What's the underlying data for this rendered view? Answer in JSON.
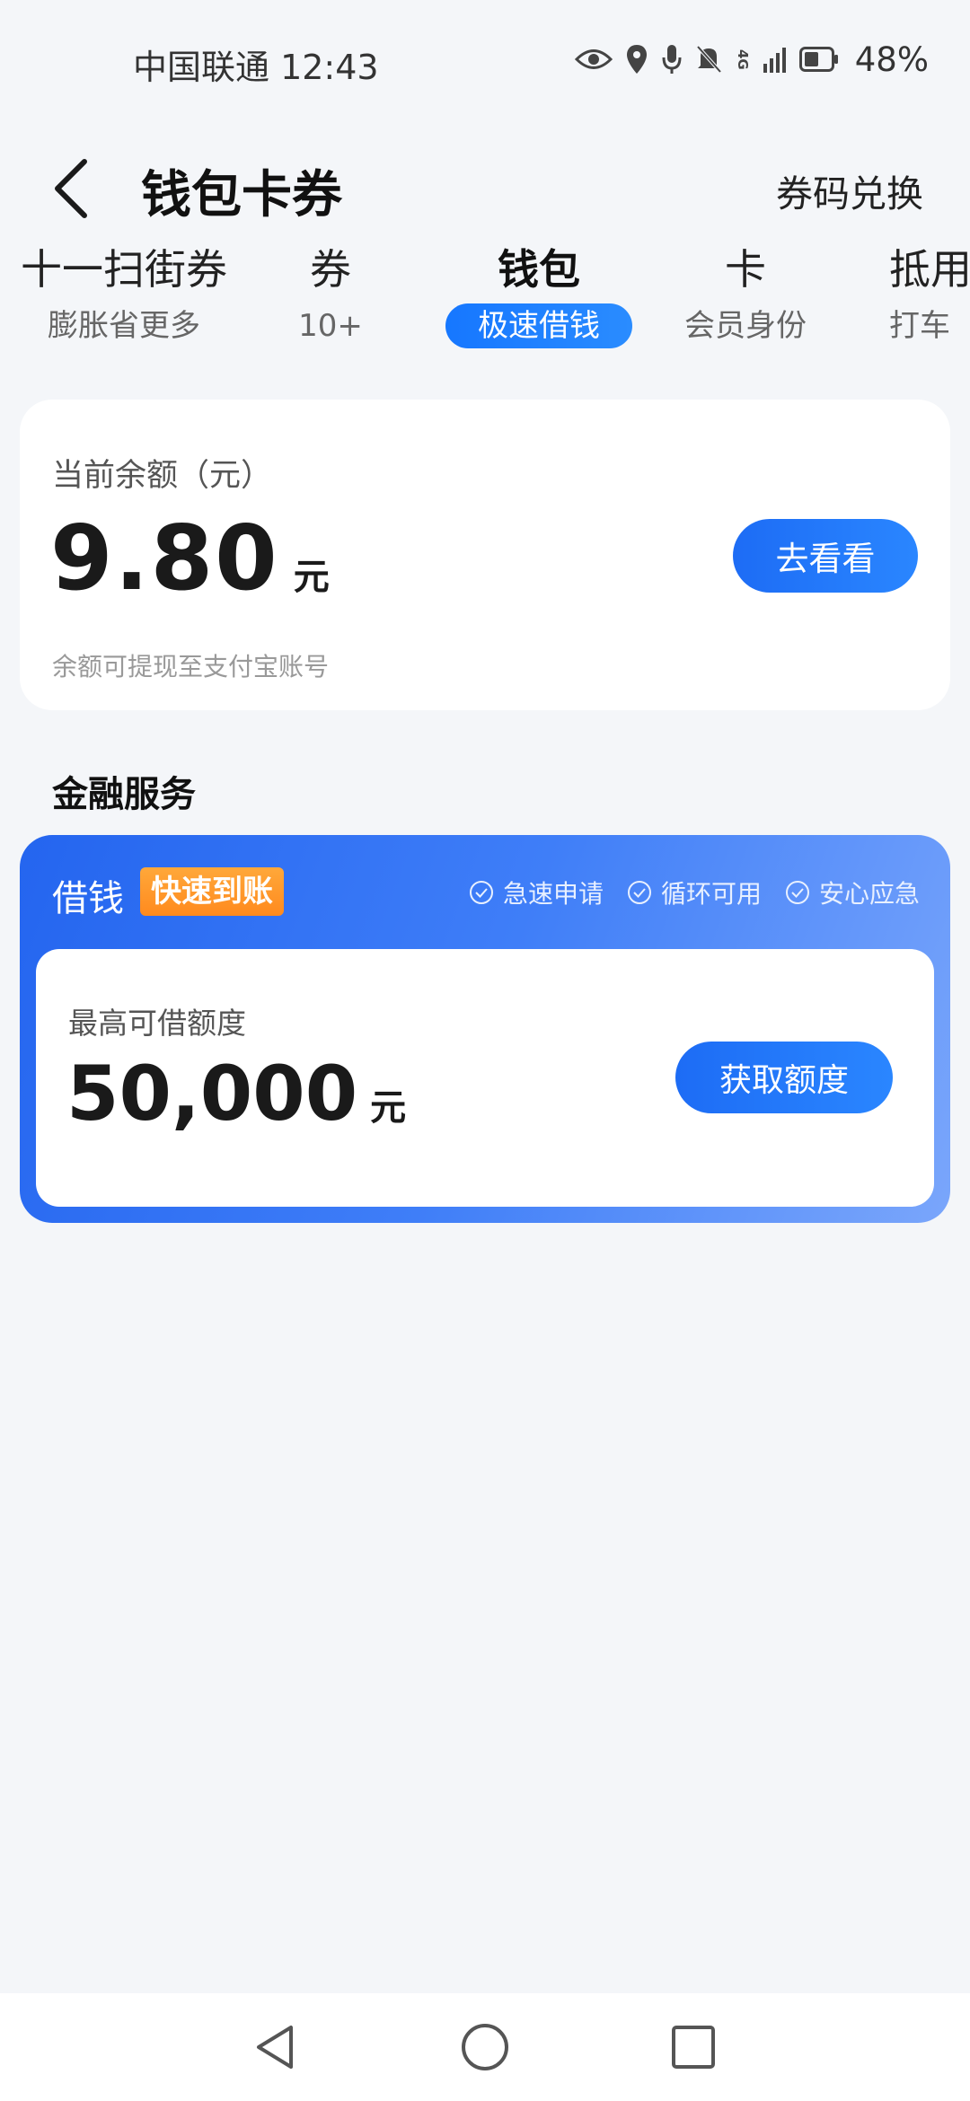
{
  "status_bar": {
    "carrier_time": "中国联通 12:43",
    "network": "4G",
    "battery": "48%"
  },
  "header": {
    "title": "钱包卡券",
    "redeem": "券码兑换"
  },
  "tabs": [
    {
      "title": "十一扫街券",
      "sub": "膨胀省更多"
    },
    {
      "title": "券",
      "sub": "10+"
    },
    {
      "title": "钱包",
      "sub": "极速借钱"
    },
    {
      "title": "卡",
      "sub": "会员身份"
    },
    {
      "title": "抵用",
      "sub": "打车"
    }
  ],
  "active_tab_index": 2,
  "balance": {
    "label": "当前余额（元）",
    "amount": "9.80",
    "unit": "元",
    "button": "去看看",
    "note": "余额可提现至支付宝账号"
  },
  "finance": {
    "section_title": "金融服务",
    "card_title": "借钱",
    "badge": "快速到账",
    "features": [
      "急速申请",
      "循环可用",
      "安心应急"
    ],
    "limit_label": "最高可借额度",
    "limit_amount": "50,000",
    "limit_unit": "元",
    "button": "获取额度"
  },
  "colors": {
    "accent": "#1d6cf5",
    "badge": "#ff9a2a",
    "background": "#f4f6f9"
  }
}
